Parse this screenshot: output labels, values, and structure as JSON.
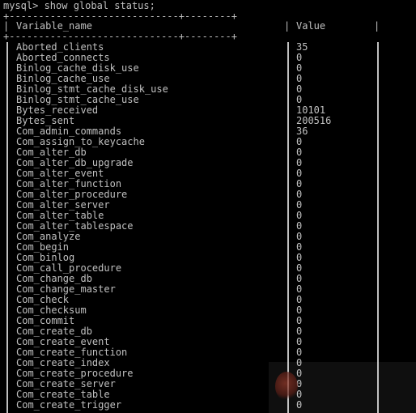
{
  "terminal": {
    "prompt": "mysql> show global status;",
    "border_top": "+-----------------------------+--------+",
    "header": {
      "variable_name": "Variable_name",
      "value": "Value"
    },
    "rows": [
      {
        "name": "Aborted_clients",
        "value": "35"
      },
      {
        "name": "Aborted_connects",
        "value": "0"
      },
      {
        "name": "Binlog_cache_disk_use",
        "value": "0"
      },
      {
        "name": "Binlog_cache_use",
        "value": "0"
      },
      {
        "name": "Binlog_stmt_cache_disk_use",
        "value": "0"
      },
      {
        "name": "Binlog_stmt_cache_use",
        "value": "0"
      },
      {
        "name": "Bytes_received",
        "value": "10101"
      },
      {
        "name": "Bytes_sent",
        "value": "200516"
      },
      {
        "name": "Com_admin_commands",
        "value": "36"
      },
      {
        "name": "Com_assign_to_keycache",
        "value": "0"
      },
      {
        "name": "Com_alter_db",
        "value": "0"
      },
      {
        "name": "Com_alter_db_upgrade",
        "value": "0"
      },
      {
        "name": "Com_alter_event",
        "value": "0"
      },
      {
        "name": "Com_alter_function",
        "value": "0"
      },
      {
        "name": "Com_alter_procedure",
        "value": "0"
      },
      {
        "name": "Com_alter_server",
        "value": "0"
      },
      {
        "name": "Com_alter_table",
        "value": "0"
      },
      {
        "name": "Com_alter_tablespace",
        "value": "0"
      },
      {
        "name": "Com_analyze",
        "value": "0"
      },
      {
        "name": "Com_begin",
        "value": "0"
      },
      {
        "name": "Com_binlog",
        "value": "0"
      },
      {
        "name": "Com_call_procedure",
        "value": "0"
      },
      {
        "name": "Com_change_db",
        "value": "0"
      },
      {
        "name": "Com_change_master",
        "value": "0"
      },
      {
        "name": "Com_check",
        "value": "0"
      },
      {
        "name": "Com_checksum",
        "value": "0"
      },
      {
        "name": "Com_commit",
        "value": "0"
      },
      {
        "name": "Com_create_db",
        "value": "0"
      },
      {
        "name": "Com_create_event",
        "value": "0"
      },
      {
        "name": "Com_create_function",
        "value": "0"
      },
      {
        "name": "Com_create_index",
        "value": "0"
      },
      {
        "name": "Com_create_procedure",
        "value": "0"
      },
      {
        "name": "Com_create_server",
        "value": "0"
      },
      {
        "name": "Com_create_table",
        "value": "0"
      },
      {
        "name": "Com_create_trigger",
        "value": "0"
      }
    ]
  },
  "colors": {
    "background": "#000000",
    "text": "#c0c0c0"
  }
}
